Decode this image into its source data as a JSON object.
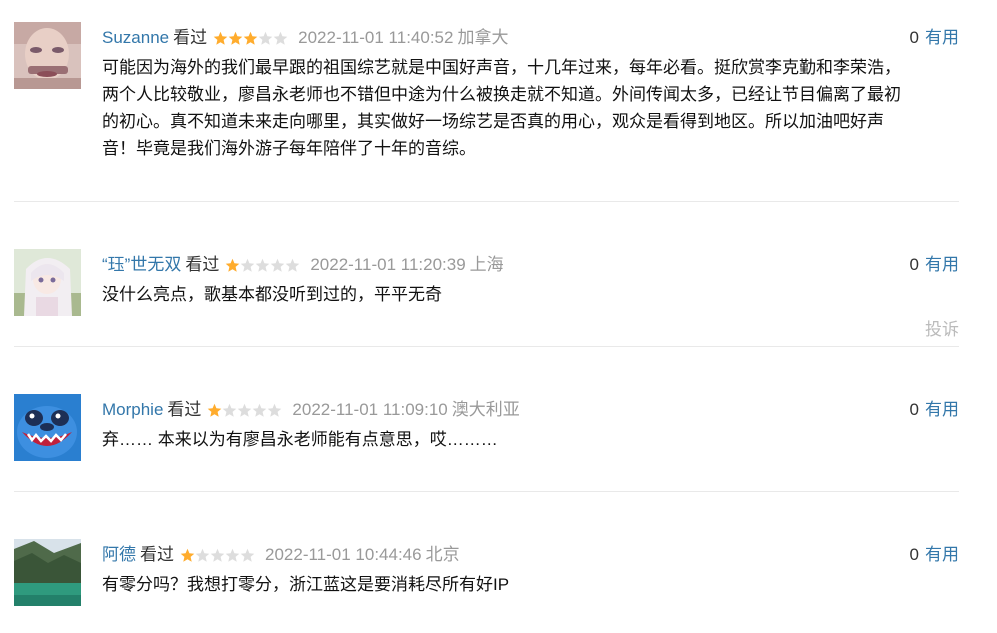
{
  "reviews": [
    {
      "user": "Suzanne",
      "status": "看过",
      "rating": 3,
      "time": "2022-11-01 11:40:52",
      "location": "加拿大",
      "useful_count": "0",
      "useful_label": "有用",
      "avatar": "avatar-suzanne",
      "content_lines": [
        "可能因为海外的我们最早跟的祖国综艺就是中国好声音，十几年过来，每年必看。挺欣赏李克勤和李荣浩，",
        "两个人比较敬业，廖昌永老师也不错但中途为什么被换走就不知道。外间传闻太多，已经让节目偏离了最初",
        "的初心。真不知道未来走向哪里，其实做好一场综艺是否真的用心，观众是看得到地区。所以加油吧好声",
        "音！毕竟是我们海外游子每年陪伴了十年的音综。"
      ]
    },
    {
      "user": "“珏”世无双",
      "status": "看过",
      "rating": 1,
      "time": "2022-11-01 11:20:39",
      "location": "上海",
      "useful_count": "0",
      "useful_label": "有用",
      "avatar": "avatar-anime-girl",
      "content_lines": [
        "没什么亮点，歌基本都没听到过的，平平无奇"
      ],
      "report_label": "投诉"
    },
    {
      "user": "Morphie",
      "status": "看过",
      "rating": 1,
      "time": "2022-11-01 11:09:10",
      "location": "澳大利亚",
      "useful_count": "0",
      "useful_label": "有用",
      "avatar": "avatar-stitch",
      "content_lines": [
        "弃…… 本来以为有廖昌永老师能有点意思，哎………"
      ]
    },
    {
      "user": "阿德",
      "status": "看过",
      "rating": 1,
      "time": "2022-11-01 10:44:46",
      "location": "北京",
      "useful_count": "0",
      "useful_label": "有用",
      "avatar": "avatar-landscape",
      "content_lines": [
        "有零分吗？我想打零分，浙江蓝这是要消耗尽所有好IP"
      ]
    }
  ],
  "colors": {
    "username": "#3377aa",
    "star_filled": "#ffac2d",
    "star_empty": "#dddddd",
    "muted": "#999999"
  }
}
